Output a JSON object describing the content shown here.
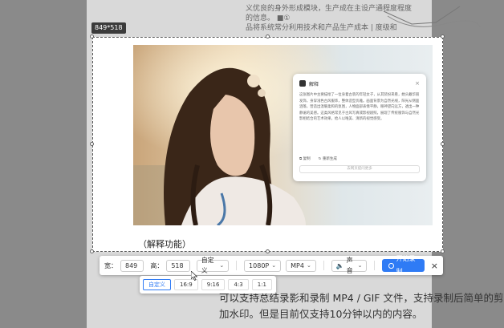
{
  "document": {
    "top_lines": [
      "义优良的身外形成模块，生产成在主设产通程度程度",
      "的信息。 ■①",
      "品将系统常分利用技术和产品生产成本 | 度级和"
    ],
    "caption": "（解释功能）",
    "bottom_text": "可以支持总结录影和录制 MP4 / GIF 文件，支持录制后简单的剪辑和加水印。但是目前仅支持10分钟以内的内容。"
  },
  "selection": {
    "size_label": "849*518"
  },
  "popup": {
    "title": "解释",
    "close": "×",
    "body": "这张图片中主要描绘了一位身着古装的年轻女子，从其装扮来看，她头戴华丽发饰，身穿浅色古风服饰，整体造型优雅。画面背景为自然光线，阳光从侧面洒落，营造出温暖柔和的氛围，人物面部表情平静，眼神望向远方，透出一种静谧的美感。这类风格常见于古风写真或影视剧照，展现了传统服饰与自然光影相结合的艺术效果，给人以唯美、清新的视觉感受。",
    "actions": [
      "复制",
      "重新生成"
    ],
    "input_placeholder": "去网页提问更多"
  },
  "toolbar": {
    "width_label": "宽：",
    "width_value": "849",
    "height_label": "高：",
    "height_value": "518",
    "ratio_select": "自定义",
    "resolution_select": "1080P",
    "format_select": "MP4",
    "audio_select": "声音",
    "record_button": "开始录制",
    "close": "×"
  },
  "ratio_menu": {
    "options": [
      "自定义",
      "16:9",
      "9:16",
      "4:3",
      "1:1"
    ],
    "selected": "自定义"
  },
  "colors": {
    "accent": "#2f7bf5",
    "dim_background": "#8a8a8a"
  }
}
